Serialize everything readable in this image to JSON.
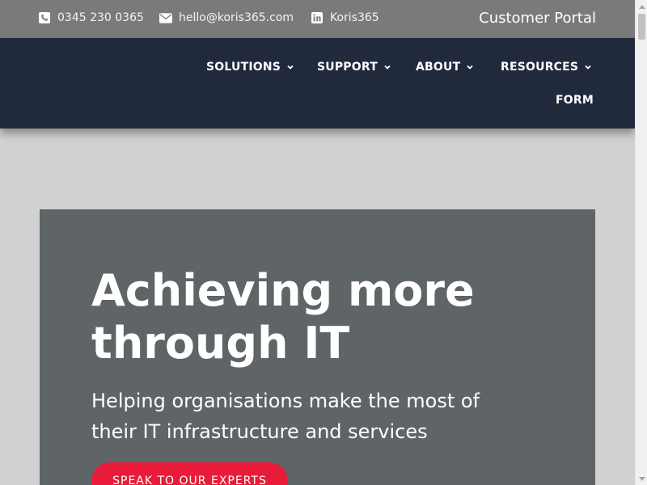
{
  "topbar": {
    "phone": {
      "label": "0345 230 0365",
      "icon": "phone-icon"
    },
    "email": {
      "label": "hello@koris365.com",
      "icon": "envelope-icon"
    },
    "linkedin": {
      "label": "Koris365",
      "icon": "linkedin-icon"
    },
    "portal_label": "Customer Portal"
  },
  "nav": {
    "items": [
      {
        "label": "SOLUTIONS",
        "has_dropdown": true
      },
      {
        "label": "SUPPORT",
        "has_dropdown": true
      },
      {
        "label": "ABOUT",
        "has_dropdown": true
      },
      {
        "label": "RESOURCES",
        "has_dropdown": true
      },
      {
        "label": "FORM",
        "has_dropdown": false
      }
    ]
  },
  "hero": {
    "title_line1": "Achieving more",
    "title_line2": "through IT",
    "subtitle_line1": "Helping organisations make the most of",
    "subtitle_line2": "their IT infrastructure and services",
    "cta_label": "SPEAK TO OUR EXPERTS"
  },
  "colors": {
    "topbar_bg": "#7a7a7a",
    "nav_bg": "#212a3d",
    "page_bg": "#d1d1d1",
    "hero_bg": "#5f6467",
    "cta_bg": "#e81c3a"
  }
}
